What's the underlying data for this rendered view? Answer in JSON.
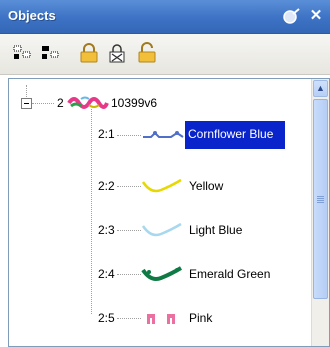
{
  "window": {
    "title": "Objects",
    "pin_icon": "pin-icon",
    "close_icon": "close-icon"
  },
  "toolbar": {
    "buttons": [
      {
        "icon": "group-expand-icon"
      },
      {
        "icon": "group-collapse-icon"
      },
      {
        "icon": "lock-icon"
      },
      {
        "icon": "hide-icon"
      },
      {
        "icon": "unlock-icon"
      }
    ]
  },
  "tree": {
    "root": {
      "prefix": "2",
      "label": "10399v6",
      "colors": [
        "#e8388a",
        "#2aa04a",
        "#c9b700",
        "#66b9e6"
      ]
    },
    "children": [
      {
        "prefix": "2:1",
        "label": "Cornflower Blue",
        "color": "#4f6fc8",
        "selected": true
      },
      {
        "prefix": "2:2",
        "label": "Yellow",
        "color": "#e6d800",
        "selected": false
      },
      {
        "prefix": "2:3",
        "label": "Light Blue",
        "color": "#a8d8ef",
        "selected": false
      },
      {
        "prefix": "2:4",
        "label": "Emerald Green",
        "color": "#0f7a44",
        "selected": false
      },
      {
        "prefix": "2:5",
        "label": "Pink",
        "color": "#ec6fa2",
        "selected": false
      }
    ]
  }
}
